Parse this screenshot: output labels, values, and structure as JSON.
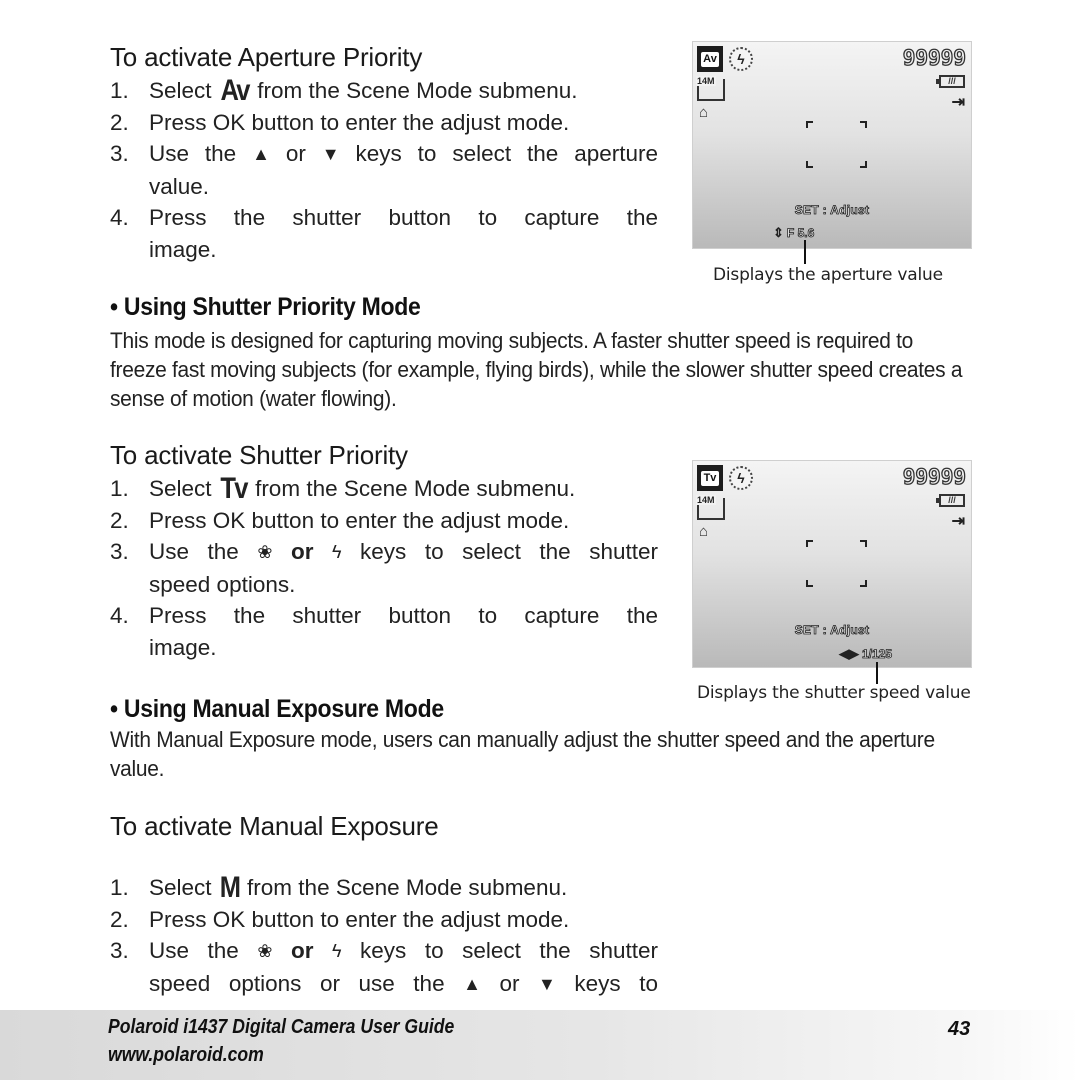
{
  "aperture": {
    "subhead": "To activate Aperture Priority",
    "mode_glyph": "Av",
    "steps": [
      {
        "num": "1.",
        "pre": "Select ",
        "post": " from the Scene Mode submenu."
      },
      {
        "num": "2.",
        "text": "Press OK button to enter the adjust mode."
      },
      {
        "num": "3.",
        "pre": "Use the ",
        "key1": "▲",
        "mid": " or ",
        "key2": "▼",
        "post_line1": " keys to select the aperture",
        "line2": "value."
      },
      {
        "num": "4.",
        "line1": "Press the shutter button to capture the",
        "line2": "image."
      }
    ],
    "screen": {
      "mode_badge": "Av",
      "flash_icon": "flash-off",
      "shots_remaining": "99999",
      "resolution": "14M",
      "battery": "///",
      "storage_icon": "⇥",
      "set_adjust": "SET : Adjust",
      "value_arrows": "⇕",
      "value": "F 5.6"
    },
    "caption": "Displays the aperture value"
  },
  "shutter_mode": {
    "title": "• Using Shutter Priority Mode",
    "body": "This mode is designed for capturing moving subjects. A faster shutter speed is required to freeze fast moving subjects (for example, flying birds), while the slower shutter speed creates a sense of motion (water flowing)."
  },
  "shutter": {
    "subhead": "To activate Shutter Priority",
    "mode_glyph": "Tv",
    "steps": [
      {
        "num": "1.",
        "pre": "Select ",
        "post": " from the Scene Mode submenu."
      },
      {
        "num": "2.",
        "text": "Press OK button to enter the adjust mode."
      },
      {
        "num": "3.",
        "pre": "Use the ",
        "key1": "❀",
        "mid": " or ",
        "key2": "ϟ",
        "post_line1": " keys to select the shutter",
        "line2": "speed options."
      },
      {
        "num": "4.",
        "line1": "Press the shutter button to capture the",
        "line2": "image."
      }
    ],
    "screen": {
      "mode_badge": "Tv",
      "flash_icon": "flash-off",
      "shots_remaining": "99999",
      "resolution": "14M",
      "battery": "///",
      "storage_icon": "⇥",
      "set_adjust": "SET : Adjust",
      "value_arrows": "◀▶",
      "value": "1/125"
    },
    "caption": "Displays the shutter speed value"
  },
  "manual_mode": {
    "title": "• Using Manual Exposure Mode",
    "body": "With Manual Exposure mode, users can manually adjust the shutter speed and the aperture value."
  },
  "manual": {
    "subhead": "To activate Manual Exposure",
    "mode_glyph": "M",
    "steps": [
      {
        "num": "1.",
        "pre": "Select ",
        "post": " from the Scene Mode submenu."
      },
      {
        "num": "2.",
        "text": "Press OK button to enter the adjust mode."
      },
      {
        "num": "3.",
        "pre": "Use the ",
        "key1": "❀",
        "mid": " or ",
        "key2": "ϟ",
        "post_line1": " keys to select the shutter",
        "line2_pre": "speed options or use the ",
        "key3": "▲",
        "line2_mid": " or ",
        "key4": "▼",
        "line2_post": " keys to"
      }
    ]
  },
  "footer": {
    "guide_title": "Polaroid i1437 Digital Camera User Guide",
    "url": "www.polaroid.com",
    "page_number": "43"
  }
}
